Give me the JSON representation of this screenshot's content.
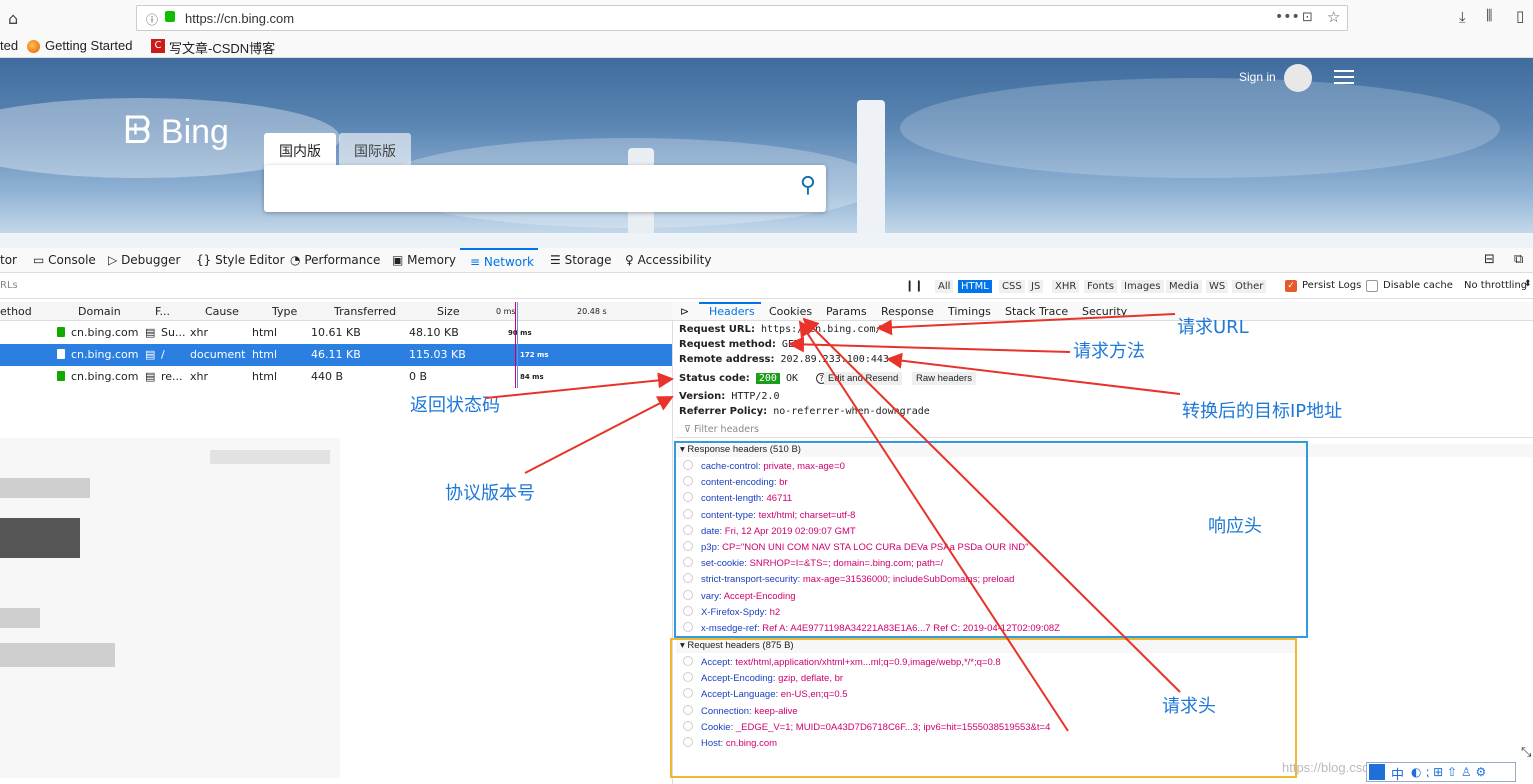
{
  "browser": {
    "url": "https://cn.bing.com",
    "bookmarks": [
      "ted",
      "Getting Started",
      "写文章-CSDN博客"
    ]
  },
  "bing": {
    "logo": "Bing",
    "tabs": [
      "国内版",
      "国际版"
    ],
    "signin": "Sign in"
  },
  "devtools": {
    "tabs": [
      "tor",
      "Console",
      "Debugger",
      "Style Editor",
      "Performance",
      "Memory",
      "Network",
      "Storage",
      "Accessibility"
    ],
    "filter_placeholder": "RLs",
    "types": [
      "All",
      "HTML",
      "CSS",
      "JS",
      "XHR",
      "Fonts",
      "Images",
      "Media",
      "WS",
      "Other"
    ],
    "persist_logs": "Persist Logs",
    "disable_cache": "Disable cache",
    "throttling": "No throttling"
  },
  "table": {
    "headers": [
      "ethod",
      "Domain",
      "F...",
      "Cause",
      "Type",
      "Transferred",
      "Size",
      "0 ms",
      "20.48 s"
    ],
    "rows": [
      {
        "domain": "cn.bing.com",
        "file": "Su...",
        "cause": "xhr",
        "type": "html",
        "transferred": "10.61 KB",
        "size": "48.10 KB",
        "time": "90 ms"
      },
      {
        "domain": "cn.bing.com",
        "file": "/",
        "cause": "document",
        "type": "html",
        "transferred": "46.11 KB",
        "size": "115.03 KB",
        "time": "172 ms"
      },
      {
        "domain": "cn.bing.com",
        "file": "re...",
        "cause": "xhr",
        "type": "html",
        "transferred": "440 B",
        "size": "0 B",
        "time": "84 ms"
      }
    ]
  },
  "details": {
    "tabs": [
      "Headers",
      "Cookies",
      "Params",
      "Response",
      "Timings",
      "Stack Trace",
      "Security"
    ],
    "request_url_label": "Request URL:",
    "request_url": "https://cn.bing.com/",
    "method_label": "Request method:",
    "method": "GET",
    "remote_label": "Remote address:",
    "remote": "202.89.233.100:443",
    "status_label": "Status code:",
    "status_code": "200",
    "status_text": "OK",
    "edit_resend": "Edit and Resend",
    "raw_headers": "Raw headers",
    "version_label": "Version:",
    "version": "HTTP/2.0",
    "referrer_label": "Referrer Policy:",
    "referrer": "no-referrer-when-downgrade",
    "filter_headers": "Filter headers",
    "response_title": "Response headers (510 B)",
    "response_headers": [
      {
        "k": "cache-control:",
        "v": "private, max-age=0"
      },
      {
        "k": "content-encoding:",
        "v": "br"
      },
      {
        "k": "content-length:",
        "v": "46711"
      },
      {
        "k": "content-type:",
        "v": "text/html; charset=utf-8"
      },
      {
        "k": "date:",
        "v": "Fri, 12 Apr 2019 02:09:07 GMT"
      },
      {
        "k": "p3p:",
        "v": "CP=\"NON UNI COM NAV STA LOC CURa DEVa PSAa PSDa OUR IND\""
      },
      {
        "k": "set-cookie:",
        "v": "SNRHOP=I=&TS=; domain=.bing.com; path=/"
      },
      {
        "k": "strict-transport-security:",
        "v": "max-age=31536000; includeSubDomains; preload"
      },
      {
        "k": "vary:",
        "v": "Accept-Encoding"
      },
      {
        "k": "X-Firefox-Spdy:",
        "v": "h2"
      },
      {
        "k": "x-msedge-ref:",
        "v": "Ref A: A4E9771198A34221A83E1A6...7 Ref C: 2019-04-12T02:09:08Z"
      }
    ],
    "request_title": "Request headers (875 B)",
    "request_headers": [
      {
        "k": "Accept:",
        "v": "text/html,application/xhtml+xm...ml;q=0.9,image/webp,*/*;q=0.8"
      },
      {
        "k": "Accept-Encoding:",
        "v": "gzip, deflate, br"
      },
      {
        "k": "Accept-Language:",
        "v": "en-US,en;q=0.5"
      },
      {
        "k": "Connection:",
        "v": "keep-alive"
      },
      {
        "k": "Cookie:",
        "v": "_EDGE_V=1; MUID=0A43D7D6718C6F...3; ipv6=hit=1555038519553&t=4"
      },
      {
        "k": "Host:",
        "v": "cn.bing.com"
      }
    ]
  },
  "annotations": {
    "request_url": "请求URL",
    "request_method": "请求方法",
    "target_ip": "转换后的目标IP地址",
    "status_code": "返回状态码",
    "protocol_version": "协议版本号",
    "response_headers": "响应头",
    "request_headers": "请求头"
  },
  "watermark": "https://blog.csdn.net/",
  "ime": "中",
  "colors": {
    "selected_row": "#2a7fe0",
    "accent": "#0074e8",
    "resp_box": "#3399e0",
    "req_box": "#f0b830",
    "annotation": "#1e78d8",
    "arrow": "#e8322a"
  }
}
